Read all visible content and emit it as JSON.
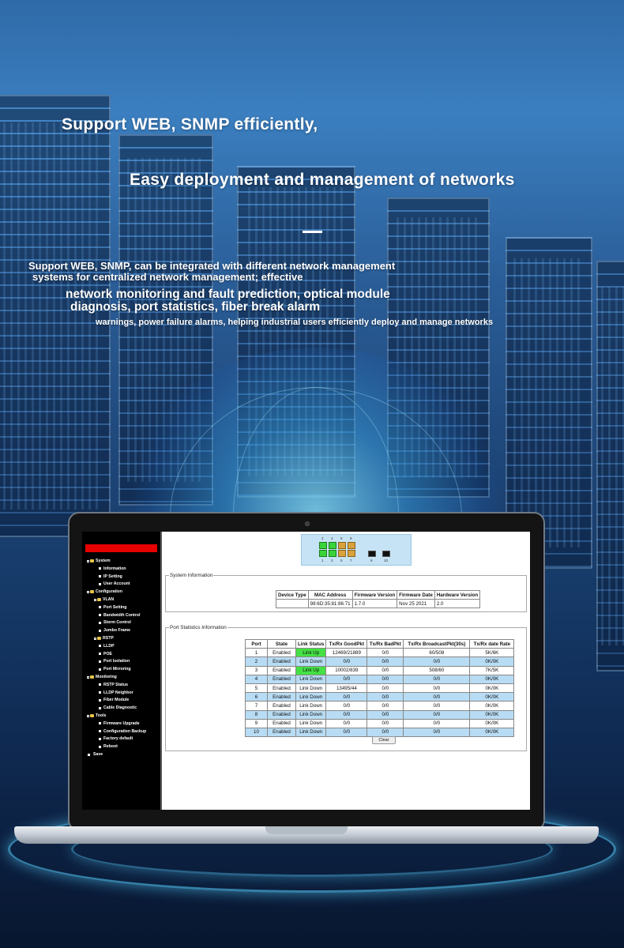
{
  "headline": {
    "line1": "Support WEB, SNMP efficiently,",
    "line2": "Easy deployment and management of networks"
  },
  "description": {
    "line1": "Support WEB, SNMP, can be integrated with different network management",
    "line2": "systems for centralized network management; effective",
    "line3": "network monitoring and fault prediction, optical module",
    "line4": "diagnosis, port statistics, fiber break alarm",
    "line5": "warnings, power failure alarms, helping industrial users efficiently deploy and manage networks"
  },
  "sidebar": {
    "items": [
      {
        "label": "System",
        "level": 0,
        "kind": "folder"
      },
      {
        "label": "Information",
        "level": 1
      },
      {
        "label": "IP Setting",
        "level": 1
      },
      {
        "label": "User Account",
        "level": 1
      },
      {
        "label": "Configuration",
        "level": 0,
        "kind": "folder"
      },
      {
        "label": "VLAN",
        "level": 1,
        "kind": "folder"
      },
      {
        "label": "Port Setting",
        "level": 1
      },
      {
        "label": "Bandwidth Control",
        "level": 1
      },
      {
        "label": "Storm Control",
        "level": 1
      },
      {
        "label": "Jumbo Frame",
        "level": 1
      },
      {
        "label": "RSTP",
        "level": 1,
        "kind": "folder"
      },
      {
        "label": "LLDP",
        "level": 1
      },
      {
        "label": "POE",
        "level": 1
      },
      {
        "label": "Port Isolation",
        "level": 1
      },
      {
        "label": "Port Mirroring",
        "level": 1
      },
      {
        "label": "Monitoring",
        "level": 0,
        "kind": "folder"
      },
      {
        "label": "RSTP Status",
        "level": 1
      },
      {
        "label": "LLDP Neighbor",
        "level": 1
      },
      {
        "label": "Fiber Module",
        "level": 1
      },
      {
        "label": "Cable Diagnostic",
        "level": 1
      },
      {
        "label": "Tools",
        "level": 0,
        "kind": "folder"
      },
      {
        "label": "Firmware Upgrade",
        "level": 1
      },
      {
        "label": "Configuration Backup",
        "level": 1
      },
      {
        "label": "Factory default",
        "level": 1
      },
      {
        "label": "Reboot",
        "level": 1
      },
      {
        "label": "Save",
        "level": 0,
        "kind": "leaf"
      }
    ]
  },
  "port_panel": {
    "top_labels": [
      "2",
      "4",
      "6",
      "8"
    ],
    "bottom_labels": [
      "1",
      "3",
      "5",
      "7"
    ],
    "sfp_labels": [
      "9",
      "10"
    ],
    "link_up_ports": [
      "1",
      "2",
      "3",
      "4"
    ]
  },
  "system_info": {
    "legend": "System Information",
    "headers": [
      "Device Type",
      "MAC Address",
      "Firmware Version",
      "Firmware Date",
      "Hardware Version"
    ],
    "row": [
      "",
      "98:6D:35:81:86:71",
      "1.7.0",
      "Nov 25 2021",
      "2.0"
    ]
  },
  "port_stats": {
    "legend": "Port Statistics Information",
    "headers": [
      "Port",
      "State",
      "Link Status",
      "Tx/Rx GoodPkt",
      "Tx/Rx BadPkt",
      "Tx/Rx BroadcastPkt(30s)",
      "Tx/Rx date Rate"
    ],
    "rows": [
      [
        "1",
        "Enabled",
        "Link Up",
        "12469/21889",
        "0/0",
        "60/508",
        "5K/6K"
      ],
      [
        "2",
        "Enabled",
        "Link Down",
        "0/0",
        "0/0",
        "0/0",
        "0K/0K"
      ],
      [
        "3",
        "Enabled",
        "Link Up",
        "10002/839",
        "0/0",
        "508/60",
        "7K/5K"
      ],
      [
        "4",
        "Enabled",
        "Link Down",
        "0/0",
        "0/0",
        "0/0",
        "0K/0K"
      ],
      [
        "5",
        "Enabled",
        "Link Down",
        "13495/44",
        "0/0",
        "0/0",
        "0K/0K"
      ],
      [
        "6",
        "Enabled",
        "Link Down",
        "0/0",
        "0/0",
        "0/0",
        "0K/0K"
      ],
      [
        "7",
        "Enabled",
        "Link Down",
        "0/0",
        "0/0",
        "0/0",
        "0K/0K"
      ],
      [
        "8",
        "Enabled",
        "Link Down",
        "0/0",
        "0/0",
        "0/0",
        "0K/0K"
      ],
      [
        "9",
        "Enabled",
        "Link Down",
        "0/0",
        "0/0",
        "0/0",
        "0K/0K"
      ],
      [
        "10",
        "Enabled",
        "Link Down",
        "0/0",
        "0/0",
        "0/0",
        "0K/0K"
      ]
    ],
    "clear_label": "Clear"
  },
  "colors": {
    "link_up": "#44e044",
    "row_alt": "#b8dcf4",
    "sidebar_bar": "#e60000"
  }
}
